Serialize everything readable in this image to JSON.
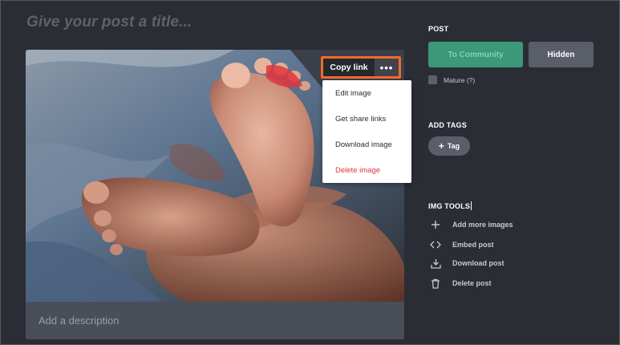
{
  "editor": {
    "title_placeholder": "Give your post a title...",
    "description_placeholder": "Add a description"
  },
  "image_toolbar": {
    "copy_link_label": "Copy link",
    "more_label": "•••"
  },
  "image_menu": {
    "items": [
      {
        "label": "Edit image"
      },
      {
        "label": "Get share links"
      },
      {
        "label": "Download image"
      },
      {
        "label": "Delete image",
        "danger": true
      }
    ]
  },
  "post_panel": {
    "heading": "POST",
    "community_button": "To Community",
    "hidden_button": "Hidden",
    "mature_label": "Mature (?)"
  },
  "tags_panel": {
    "heading": "ADD TAGS",
    "tag_button": "Tag",
    "tag_plus": "+"
  },
  "tools_panel": {
    "heading": "IMG TOOLS",
    "items": [
      {
        "label": "Add more images",
        "icon": "plus-icon"
      },
      {
        "label": "Embed post",
        "icon": "code-icon"
      },
      {
        "label": "Download post",
        "icon": "download-icon"
      },
      {
        "label": "Delete post",
        "icon": "trash-icon"
      }
    ]
  },
  "colors": {
    "background": "#2b2d35",
    "accent_green": "#3d9779",
    "highlight_orange": "#f16a2b",
    "danger_red": "#e0353d"
  }
}
